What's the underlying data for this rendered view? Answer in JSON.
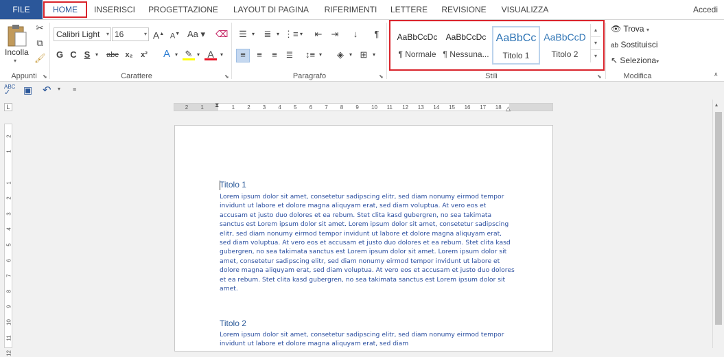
{
  "tabs": {
    "file": "FILE",
    "home": "HOME",
    "inserisci": "INSERISCI",
    "progettazione": "PROGETTAZIONE",
    "layout": "LAYOUT DI PAGINA",
    "riferimenti": "RIFERIMENTI",
    "lettere": "LETTERE",
    "revisione": "REVISIONE",
    "visualizza": "VISUALIZZA",
    "account": "Accedi"
  },
  "ribbon": {
    "appunti": {
      "label": "Appunti",
      "paste_label": "Incolla"
    },
    "carattere": {
      "label": "Carattere",
      "font_name": "Calibri Light",
      "font_size": "16",
      "bold": "G",
      "italic": "C",
      "underline": "S",
      "strike": "abc",
      "subscript": "x₂",
      "superscript": "x²",
      "grow": "A",
      "shrink": "A",
      "case": "Aa",
      "highlight_color": "#ffff00",
      "font_color": "#e81123"
    },
    "paragrafo": {
      "label": "Paragrafo"
    },
    "stili": {
      "label": "Stili",
      "items": [
        {
          "preview": "AaBbCcDc",
          "name": "¶ Normale"
        },
        {
          "preview": "AaBbCcDc",
          "name": "¶ Nessuna..."
        },
        {
          "preview": "AaBbCc",
          "name": "Titolo 1"
        },
        {
          "preview": "AaBbCcD",
          "name": "Titolo 2"
        }
      ]
    },
    "modifica": {
      "label": "Modifica",
      "trova": "Trova",
      "sostituisci": "Sostituisci",
      "seleziona": "Seleziona"
    }
  },
  "ruler": {
    "ticks": [
      "2",
      "1",
      "1",
      "2",
      "3",
      "4",
      "5",
      "6",
      "7",
      "8",
      "9",
      "10",
      "11",
      "12",
      "13",
      "14",
      "15",
      "16",
      "17",
      "18"
    ],
    "vticks": [
      "2",
      "1",
      "1",
      "2",
      "3",
      "4",
      "5",
      "6",
      "7",
      "8",
      "9",
      "10",
      "11",
      "12"
    ]
  },
  "document": {
    "heading1": "Titolo 1",
    "para1": "Lorem ipsum dolor sit amet, consetetur sadipscing elitr, sed diam nonumy eirmod tempor invidunt ut labore et dolore magna aliquyam erat, sed diam voluptua. At vero eos et accusam et justo duo dolores et ea rebum. Stet clita kasd gubergren, no sea takimata sanctus est Lorem ipsum dolor sit amet. Lorem ipsum dolor sit amet, consetetur sadipscing elitr, sed diam nonumy eirmod tempor invidunt ut labore et dolore magna aliquyam erat, sed diam voluptua. At vero eos et accusam et justo duo dolores et ea rebum. Stet clita kasd gubergren, no sea takimata sanctus est Lorem ipsum dolor sit amet. Lorem ipsum dolor sit amet, consetetur sadipscing elitr, sed diam nonumy eirmod tempor invidunt ut labore et dolore magna aliquyam erat, sed diam voluptua. At vero eos et accusam et justo duo dolores et ea rebum. Stet clita kasd gubergren, no sea takimata sanctus est Lorem ipsum dolor sit amet.",
    "heading2": "Titolo 2",
    "para2": "Lorem ipsum dolor sit amet, consetetur sadipscing elitr, sed diam nonumy eirmod tempor invidunt ut labore et dolore magna aliquyam erat, sed diam"
  },
  "colors": {
    "accent": "#2b579a",
    "highlight_border": "#d9232b",
    "text_blue": "#2b4fa0"
  }
}
